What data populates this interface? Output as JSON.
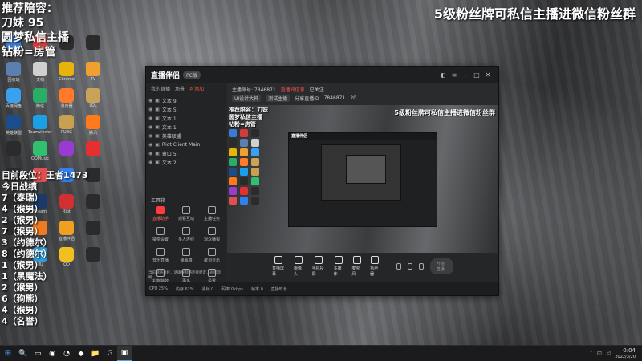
{
  "overlay": {
    "top_lines": [
      "推荐陪容：",
      "刀妹 95",
      "圆梦私信主播",
      "钻粉=房管"
    ],
    "title": "5级粉丝牌可私信主播进微信粉丝群",
    "rank_header": "目前段位：王者1473",
    "rank_sub": "今日战绩",
    "ranks": [
      "7（泰瑞）",
      "4（猴男）",
      "2（猴男）",
      "7（猴男）",
      "3（约德尔）",
      "8（约德尔）",
      "1（猴男）",
      "1（黑魔法）",
      "2（猴男）",
      "6（狗熊）",
      "4（猴男）",
      "4（名誉）"
    ]
  },
  "desktop_icons": [
    {
      "label": "Network",
      "color": "#3a7bd5"
    },
    {
      "label": "WPS",
      "color": "#d43a3a"
    },
    {
      "label": "",
      "color": "#2b2b2b"
    },
    {
      "label": "",
      "color": "#2b2b2b"
    },
    {
      "label": "回收站",
      "color": "#5a7fb0"
    },
    {
      "label": "文档",
      "color": "#d0d0d0"
    },
    {
      "label": "Chrome",
      "color": "#e8b40a"
    },
    {
      "label": "TV",
      "color": "#f0a030"
    },
    {
      "label": "百度网盘",
      "color": "#3aa0f0"
    },
    {
      "label": "微信",
      "color": "#2aae67"
    },
    {
      "label": "浏览器",
      "color": "#ff7a2a"
    },
    {
      "label": "LOL",
      "color": "#c9a35a"
    },
    {
      "label": "英雄联盟",
      "color": "#1b4d8c"
    },
    {
      "label": "Teamviewer",
      "color": "#1aa0e6"
    },
    {
      "label": "PUBG",
      "color": "#c8a050"
    },
    {
      "label": "腾讯",
      "color": "#ff7a1a"
    },
    {
      "label": "",
      "color": "#2b2b2b"
    },
    {
      "label": "QQMusic",
      "color": "#30c070"
    },
    {
      "label": "",
      "color": "#9a3ad0"
    },
    {
      "label": "",
      "color": "#e63030"
    },
    {
      "label": "",
      "color": "#2b2b2b"
    },
    {
      "label": "",
      "color": "#e05050"
    },
    {
      "label": "",
      "color": "#3080f0"
    },
    {
      "label": "",
      "color": "#2b2b2b"
    },
    {
      "label": "",
      "color": "#2b2b2b"
    },
    {
      "label": "Steam",
      "color": "#1a3a6a"
    },
    {
      "label": "Riot",
      "color": "#d03030"
    },
    {
      "label": "",
      "color": "#2b2b2b"
    },
    {
      "label": "",
      "color": "#2b2b2b"
    },
    {
      "label": "",
      "color": "#f07a20"
    },
    {
      "label": "直播伴侣",
      "color": "#f0a020"
    },
    {
      "label": "",
      "color": "#2b2b2b"
    },
    {
      "label": "",
      "color": "#2b2b2b"
    },
    {
      "label": "UU",
      "color": "#30a0e0"
    },
    {
      "label": "QQ",
      "color": "#f0c020"
    },
    {
      "label": "",
      "color": "#2b2b2b"
    }
  ],
  "app": {
    "logo": "直播伴侣",
    "version": "PC版",
    "scene_tabs": [
      "我的直播",
      "场景",
      "可添加"
    ],
    "sources": [
      "文本 9",
      "文本 5",
      "文本 1",
      "文本 1",
      "英雄联盟",
      "Riot Client Main",
      "窗口 5",
      "文本 2"
    ],
    "toolbox_title": "工具箱",
    "tools": [
      "直播助手",
      "观看互动",
      "主播任务",
      "抽奖设置",
      "多人连线",
      "观众播报",
      "音乐直播",
      "弹幕墙",
      "歌词显示",
      "礼物特效",
      "更多",
      "设置"
    ],
    "live_row1": [
      "主播账号: 7846871",
      "直播间信息",
      "已关注"
    ],
    "live_row2": [
      "UI设计大神",
      "测试主播",
      "分享直播ID",
      "7846871",
      "20"
    ],
    "preview_text": [
      "推荐陪容：刀妹",
      "圆梦私信主播",
      "钻粉=房管"
    ],
    "preview_title": "5级粉丝牌可私信主播进微信粉丝群",
    "nested_title": "直播伴侣",
    "controls": [
      "直播屏幕",
      "摄像头",
      "手机投屏",
      "多媒体",
      "麦克风",
      "扬声器"
    ],
    "start_live": "开始直播",
    "notice": "当前网络良好，请确保网络连接稳定，画面流畅",
    "status": [
      "CPU 25%",
      "内存 62%",
      "丢帧 0",
      "码率 0kbps",
      "帧率 0",
      "直播时长"
    ]
  },
  "taskbar": {
    "start": "⊞",
    "icons": [
      "🔍",
      "▭",
      "◉",
      "◔",
      "◆",
      "📁",
      "G",
      "▣"
    ],
    "time": "0:04",
    "date": "2022/3/20"
  }
}
